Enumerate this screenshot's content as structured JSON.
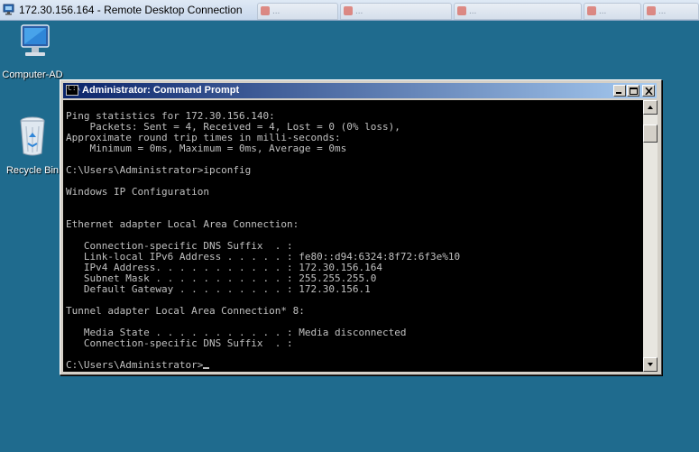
{
  "remote_desktop": {
    "title": "172.30.156.164 - Remote Desktop Connection",
    "background_tabs": [
      "...",
      "...",
      "...",
      "...",
      "..."
    ]
  },
  "desktop": {
    "icons": [
      {
        "label": "Computer-AD",
        "icon": "computer-icon"
      },
      {
        "label": "Recycle Bin",
        "icon": "recycle-bin-icon"
      }
    ]
  },
  "cmd_window": {
    "title": "Administrator: Command Prompt",
    "lines": [
      "",
      "Ping statistics for 172.30.156.140:",
      "    Packets: Sent = 4, Received = 4, Lost = 0 (0% loss),",
      "Approximate round trip times in milli-seconds:",
      "    Minimum = 0ms, Maximum = 0ms, Average = 0ms",
      "",
      "C:\\Users\\Administrator>ipconfig",
      "",
      "Windows IP Configuration",
      "",
      "",
      "Ethernet adapter Local Area Connection:",
      "",
      "   Connection-specific DNS Suffix  . :",
      "   Link-local IPv6 Address . . . . . : fe80::d94:6324:8f72:6f3e%10",
      "   IPv4 Address. . . . . . . . . . . : 172.30.156.164",
      "   Subnet Mask . . . . . . . . . . . : 255.255.255.0",
      "   Default Gateway . . . . . . . . . : 172.30.156.1",
      "",
      "Tunnel adapter Local Area Connection* 8:",
      "",
      "   Media State . . . . . . . . . . . : Media disconnected",
      "   Connection-specific DNS Suffix  . :",
      "",
      "C:\\Users\\Administrator>"
    ]
  },
  "colors": {
    "desktop_bg": "#1f6b8e",
    "console_bg": "#000000",
    "console_fg": "#c0c0c0",
    "titlebar_start": "#0a246a",
    "titlebar_end": "#a6caf0"
  }
}
